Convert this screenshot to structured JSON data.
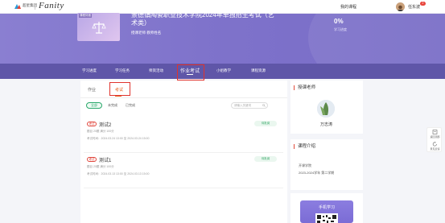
{
  "topbar": {
    "logo_cn": "超星集团",
    "logo_en": "Fanity",
    "my_course": "我的课程",
    "user_name": "任东波",
    "badge_count": "2"
  },
  "banner": {
    "cover_label": "课程封面",
    "title": "景德镇陶瓷职业技术学院2024年单独招生考试（艺术类）",
    "teacher_line": "授课老师 教师姓名",
    "progress": "0%",
    "progress_label": "学习进度"
  },
  "nav": {
    "items": [
      "学习进度",
      "学习任务",
      "师资活动",
      "作业考试",
      "小组教学",
      "课程资源"
    ]
  },
  "subtabs": [
    "作业",
    "考试"
  ],
  "filters": [
    "全部",
    "未完成",
    "已完成"
  ],
  "search_placeholder": "请输入关键词",
  "tasks": [
    {
      "tag": "考试",
      "title": "测试2",
      "meta": "题目 20题   满分 100分",
      "time": "考试时间：2024.03.24 13:00 至 2024.03.24 15:00",
      "status": "待批阅"
    },
    {
      "tag": "考试",
      "title": "测试1",
      "meta": "题目 20题   满分 100分",
      "time": "考试时间：2024.03.13 13:00 至 2024.03.13 15:00",
      "status": "待批阅"
    }
  ],
  "side": {
    "teacher_head": "授课老师",
    "teacher_name": "万志涛",
    "intro_head": "课程介绍",
    "intro_line1": "开课学院",
    "intro_line2": "2023-2024学年 第二学期",
    "mobile_learning": "手机学习"
  },
  "float_panel": {
    "item1": "返回顶部",
    "item2": "意见反馈"
  }
}
